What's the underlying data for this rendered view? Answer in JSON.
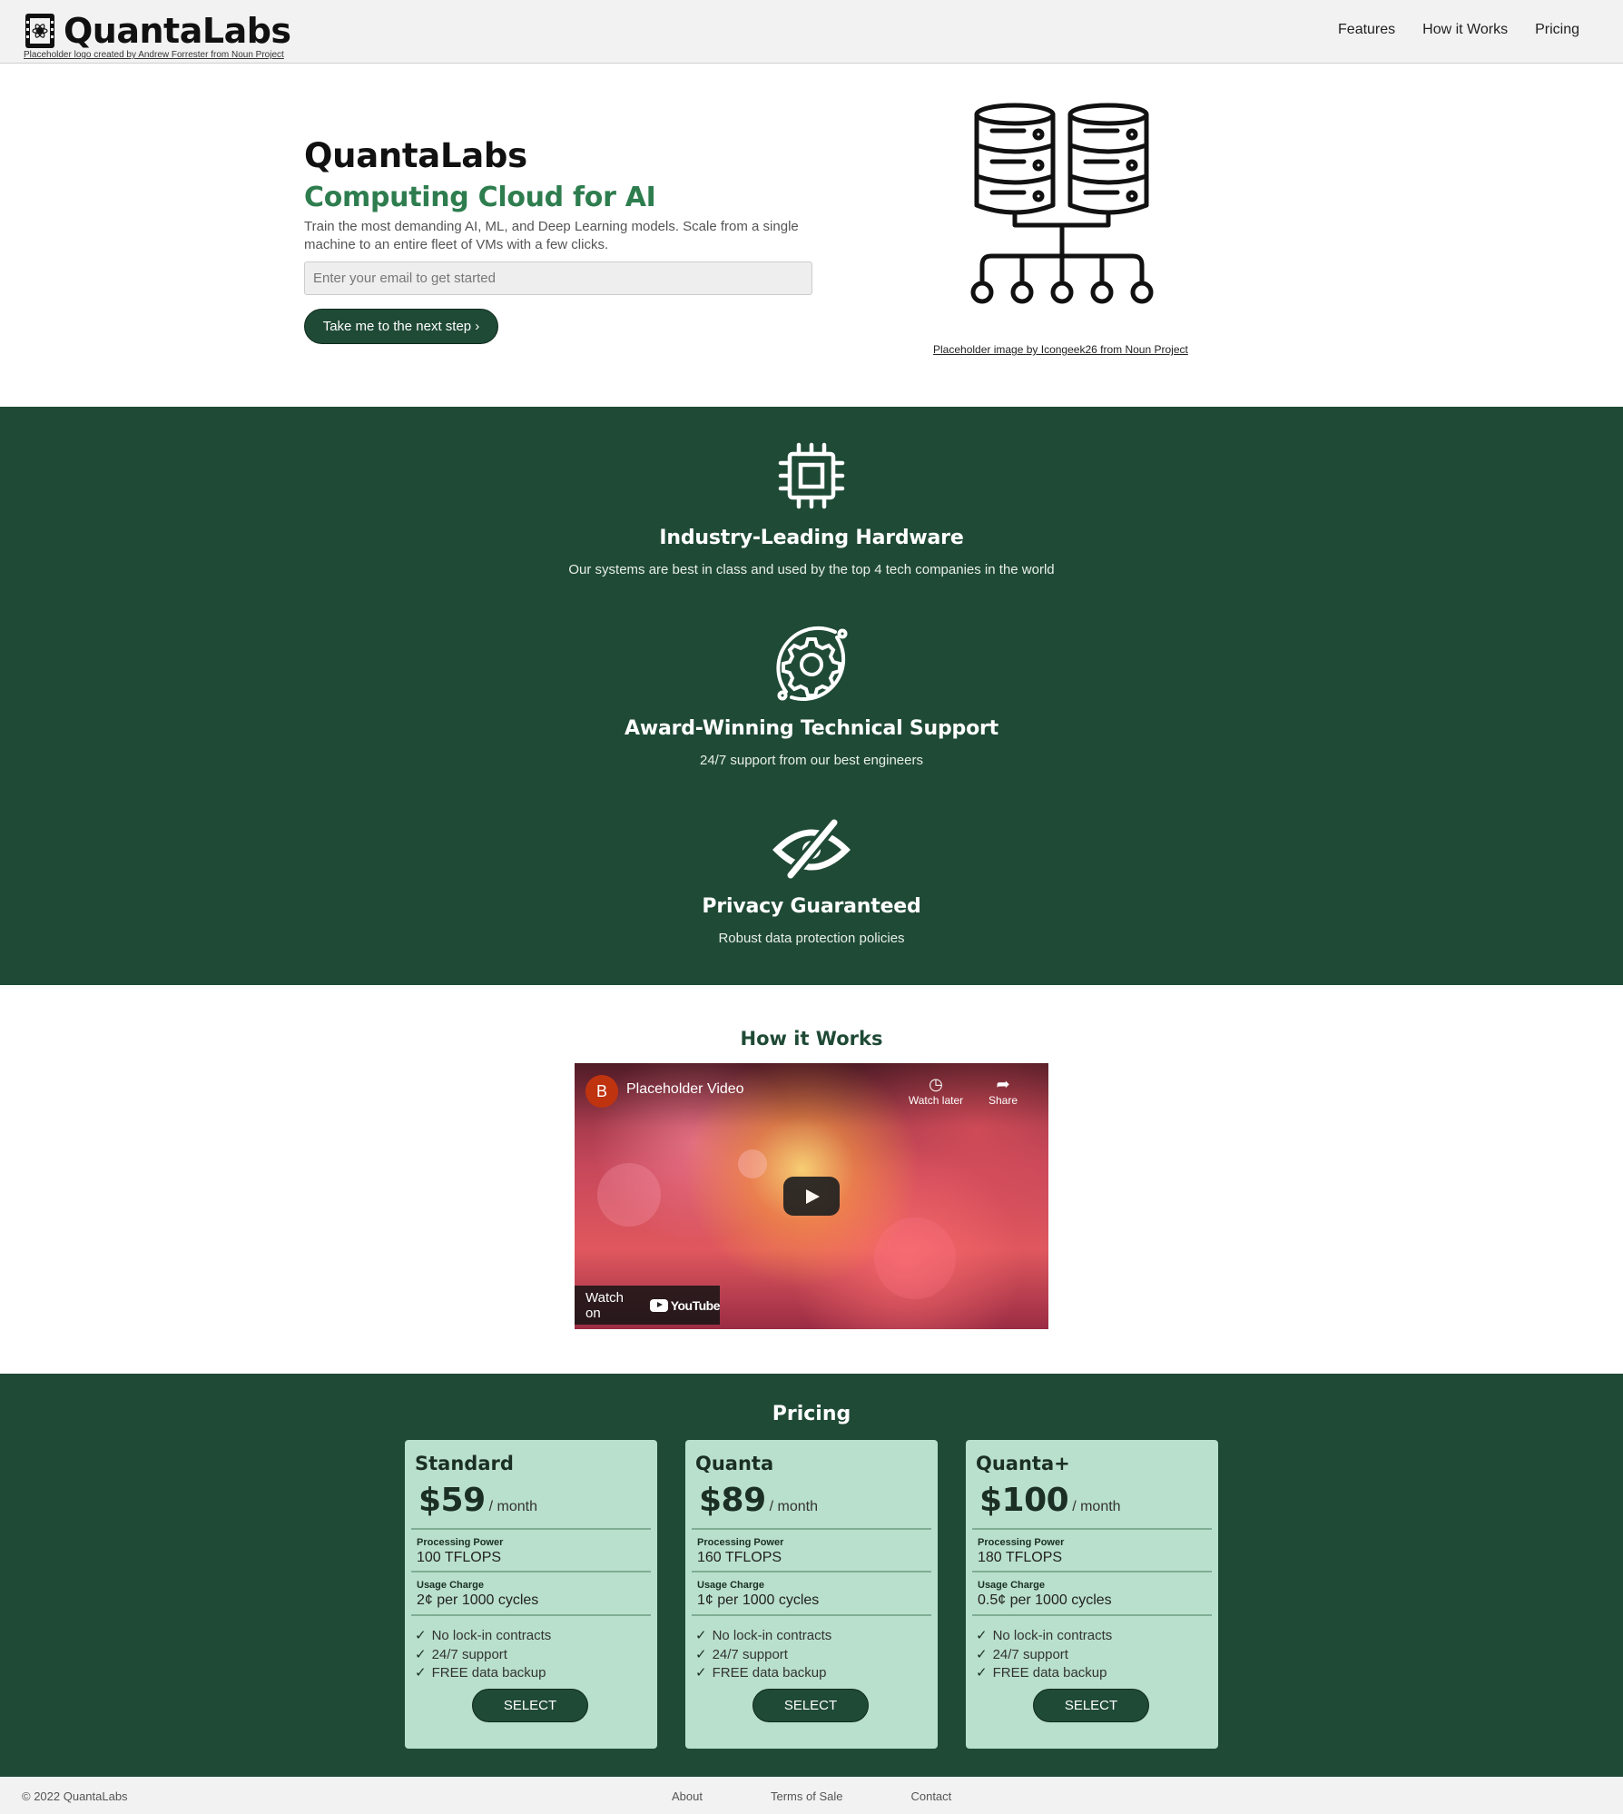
{
  "header": {
    "logo_text": "QuantaLabs",
    "logo_credit": "Placeholder logo created by Andrew Forrester from Noun Project",
    "nav": [
      "Features",
      "How it Works",
      "Pricing"
    ]
  },
  "hero": {
    "title": "QuantaLabs",
    "subtitle": "Computing Cloud for AI",
    "description": "Train the most demanding AI, ML, and Deep Learning models. Scale from a single machine to an entire fleet of VMs with a few clicks.",
    "email_placeholder": "Enter your email to get started",
    "cta": "Take me to the next step ›",
    "image_credit": "Placeholder image by Icongeek26 from Noun Project"
  },
  "features": [
    {
      "icon": "cpu-chip-icon",
      "title": "Industry-Leading Hardware",
      "text": "Our systems are best in class and used by the top 4 tech companies in the world"
    },
    {
      "icon": "gear-support-icon",
      "title": "Award-Winning Technical Support",
      "text": "24/7 support from our best engineers"
    },
    {
      "icon": "eye-slash-icon",
      "title": "Privacy Guaranteed",
      "text": "Robust data protection policies"
    }
  ],
  "how_it_works": {
    "title": "How it Works",
    "video": {
      "channel_initial": "B",
      "title": "Placeholder Video",
      "watch_later": "Watch later",
      "share": "Share",
      "watch_on": "Watch on",
      "youtube": "YouTube"
    }
  },
  "pricing": {
    "title": "Pricing",
    "plans": [
      {
        "name": "Standard",
        "price": "$59",
        "period": "/ month",
        "power_label": "Processing Power",
        "power": "100 TFLOPS",
        "charge_label": "Usage Charge",
        "charge": "2¢ per 1000 cycles",
        "features": [
          "No lock-in contracts",
          "24/7 support",
          "FREE data backup"
        ],
        "button": "SELECT"
      },
      {
        "name": "Quanta",
        "price": "$89",
        "period": "/ month",
        "power_label": "Processing Power",
        "power": "160 TFLOPS",
        "charge_label": "Usage Charge",
        "charge": "1¢ per 1000 cycles",
        "features": [
          "No lock-in contracts",
          "24/7 support",
          "FREE data backup"
        ],
        "button": "SELECT"
      },
      {
        "name": "Quanta+",
        "price": "$100",
        "period": "/ month",
        "power_label": "Processing Power",
        "power": "180 TFLOPS",
        "charge_label": "Usage Charge",
        "charge": "0.5¢ per 1000 cycles",
        "features": [
          "No lock-in contracts",
          "24/7 support",
          "FREE data backup"
        ],
        "button": "SELECT"
      }
    ]
  },
  "footer": {
    "copyright": "© 2022 QuantaLabs",
    "links": [
      "About",
      "Terms of Sale",
      "Contact"
    ]
  },
  "colors": {
    "brand_dark": "#1f4a36",
    "brand_green": "#2e7d4f",
    "card_bg": "#b9e0cc"
  }
}
